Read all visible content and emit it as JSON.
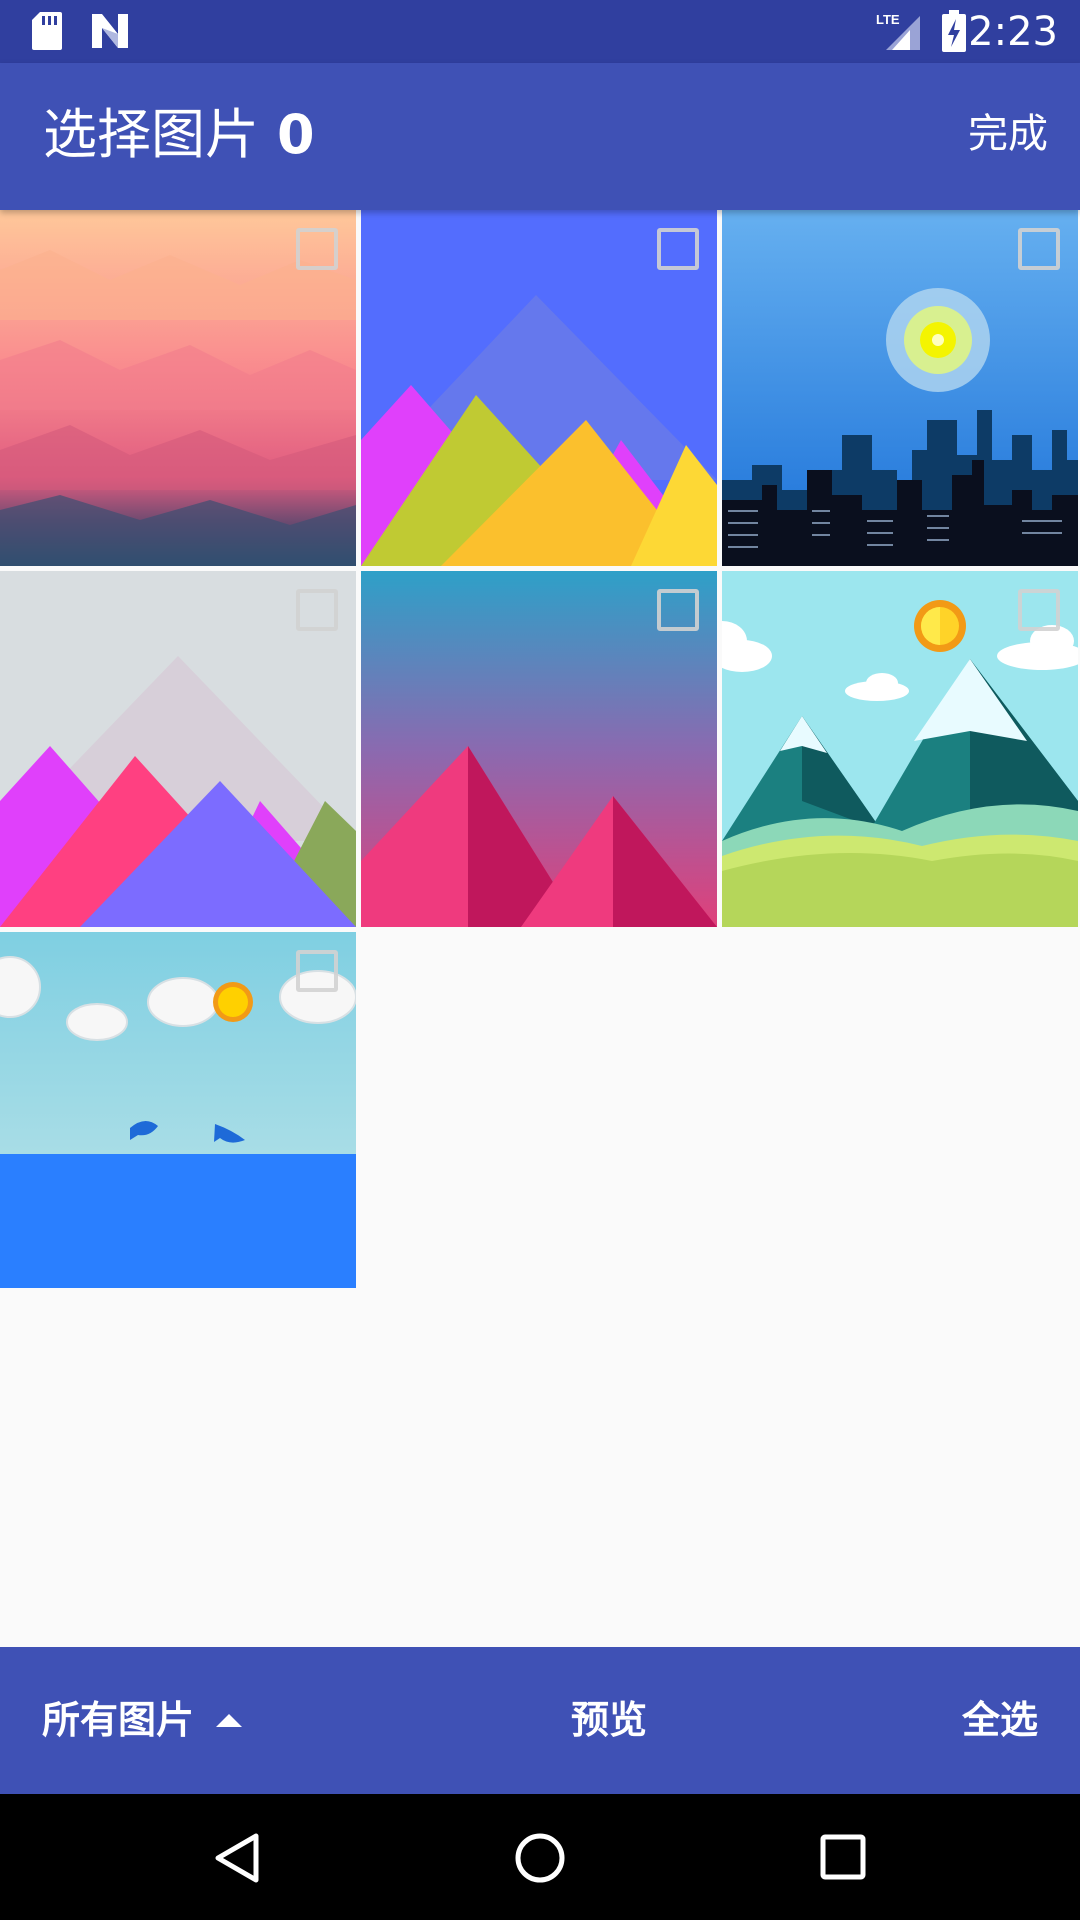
{
  "status_bar": {
    "time": "2:23",
    "network": "LTE",
    "icons": [
      "sd-card-icon",
      "android-n-icon",
      "lte-signal-icon",
      "battery-charging-icon"
    ]
  },
  "app_bar": {
    "title": "选择图片",
    "selected_count": "0",
    "done_label": "完成"
  },
  "gallery": {
    "images": [
      {
        "name": "pink-lowpoly-wallpaper",
        "selected": false
      },
      {
        "name": "blue-triangles-wallpaper",
        "selected": false
      },
      {
        "name": "city-skyline-wallpaper",
        "selected": false
      },
      {
        "name": "grey-pink-triangles-wallpaper",
        "selected": false
      },
      {
        "name": "pink-pyramids-wallpaper",
        "selected": false
      },
      {
        "name": "snowy-mountains-wallpaper",
        "selected": false
      },
      {
        "name": "sky-whales-wallpaper",
        "selected": false
      }
    ]
  },
  "bottom_bar": {
    "folder_label": "所有图片",
    "preview_label": "预览",
    "select_all_label": "全选"
  },
  "nav_bar": {
    "icons": [
      "back-icon",
      "home-icon",
      "recents-icon"
    ]
  },
  "colors": {
    "primary": "#3f51b5",
    "primary_dark": "#303f9f",
    "background": "#fafafa"
  }
}
